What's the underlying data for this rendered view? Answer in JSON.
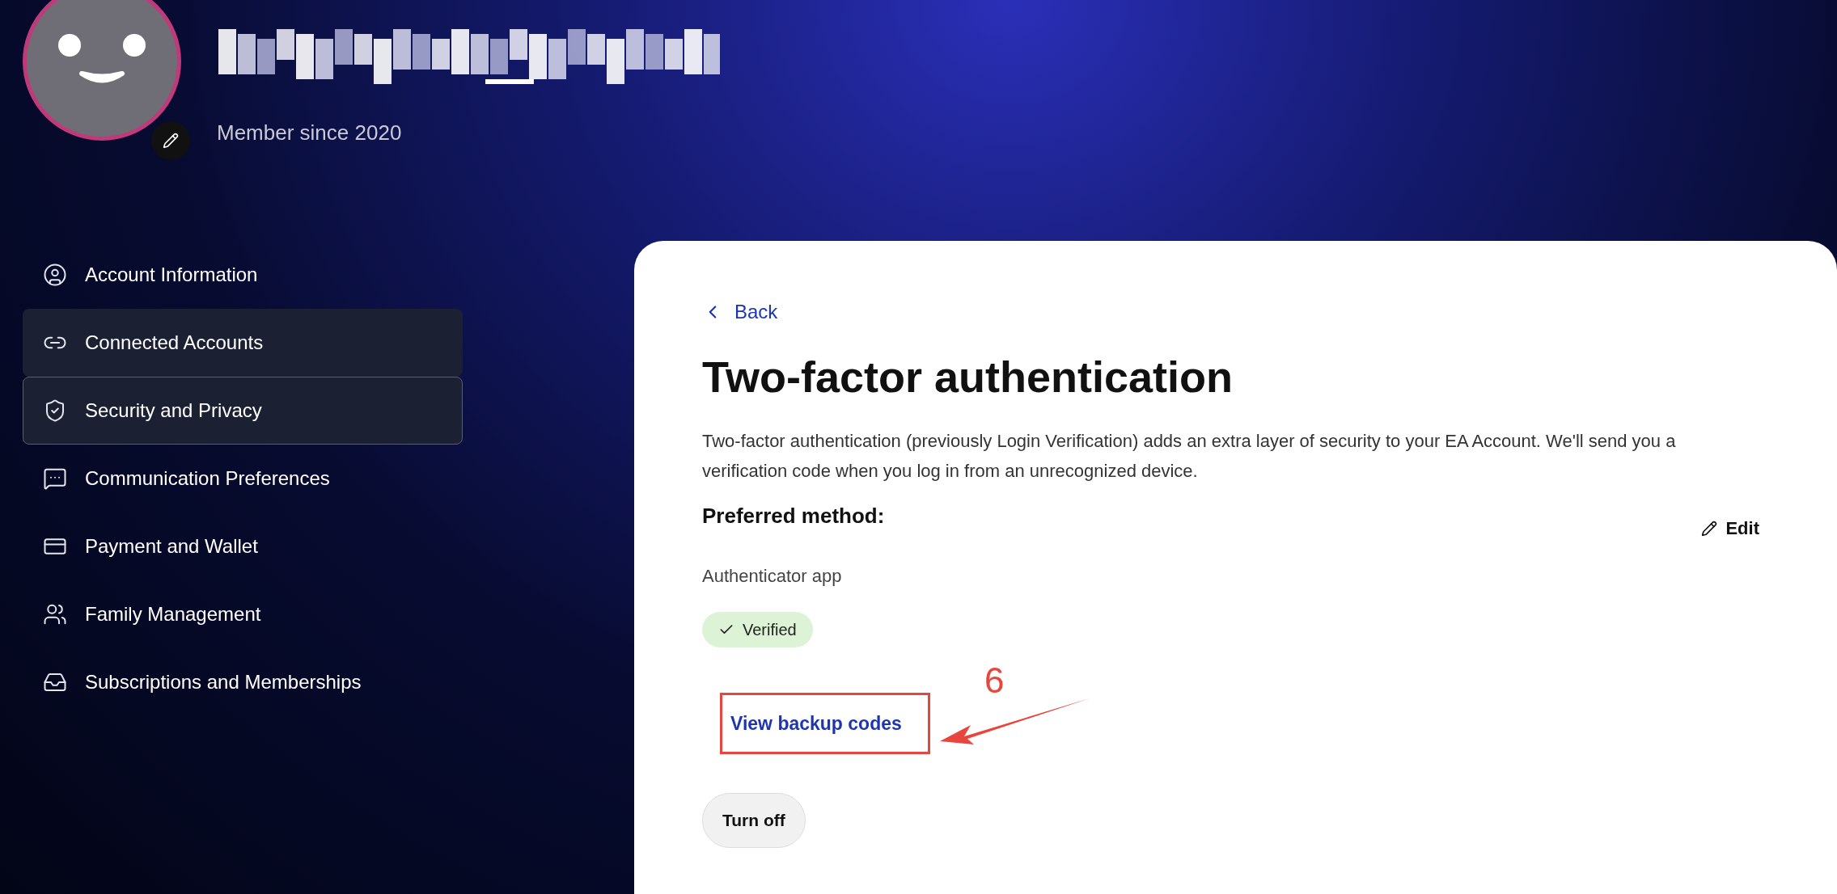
{
  "profile": {
    "member_since": "Member since 2020"
  },
  "sidebar": {
    "items": [
      {
        "label": "Account Information",
        "kind": "user",
        "selected": false
      },
      {
        "label": "Connected Accounts",
        "kind": "link",
        "selected": false,
        "hovered": true
      },
      {
        "label": "Security and Privacy",
        "kind": "shield",
        "selected": true
      },
      {
        "label": "Communication Preferences",
        "kind": "chat",
        "selected": false
      },
      {
        "label": "Payment and Wallet",
        "kind": "card",
        "selected": false
      },
      {
        "label": "Family Management",
        "kind": "people",
        "selected": false
      },
      {
        "label": "Subscriptions and Memberships",
        "kind": "inbox",
        "selected": false
      }
    ]
  },
  "panel": {
    "back": "Back",
    "title": "Two-factor authentication",
    "description": "Two-factor authentication (previously Login Verification) adds an extra layer of security to your EA Account. We'll send you a verification code when you log in from an unrecognized device.",
    "preferred_label": "Preferred method:",
    "edit": "Edit",
    "method": "Authenticator app",
    "status": "Verified",
    "backup_link": "View backup codes",
    "turn_off": "Turn off"
  },
  "annotation": {
    "label": "6"
  }
}
